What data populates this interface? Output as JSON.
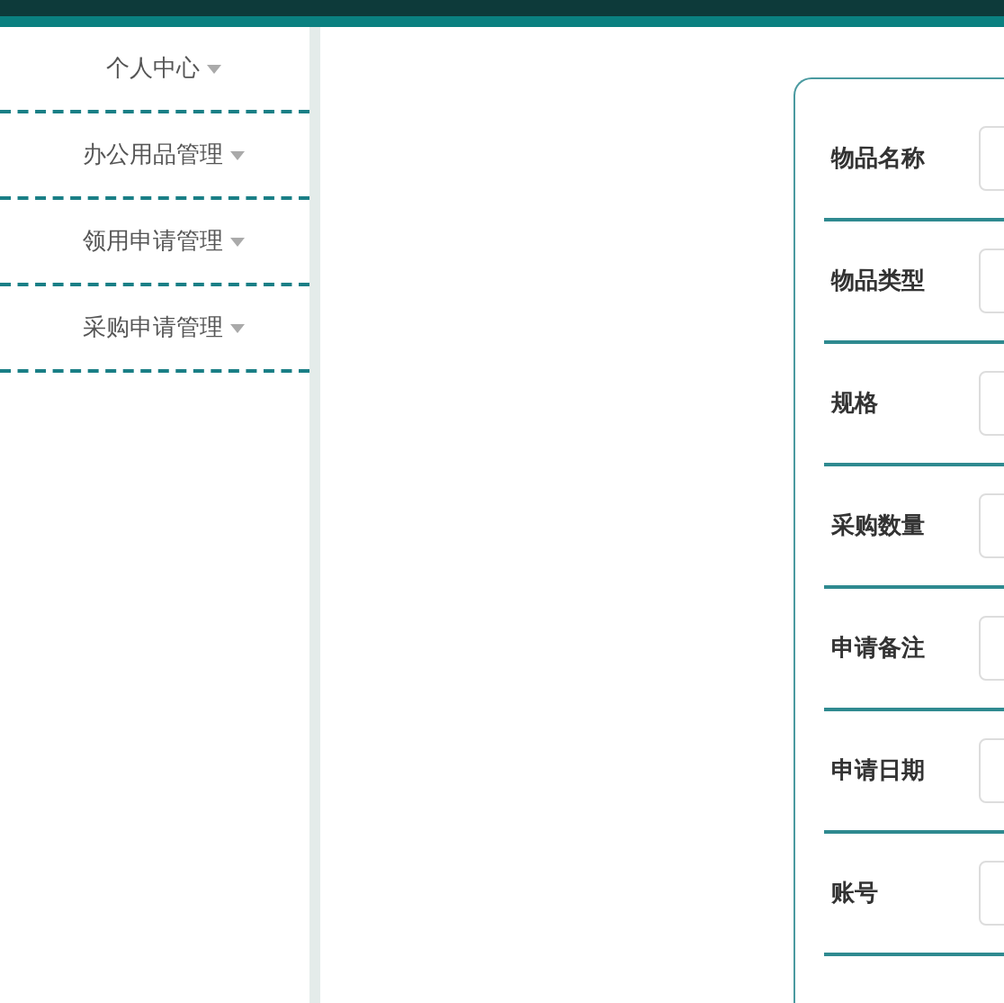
{
  "sidebar": {
    "items": [
      {
        "label": "个人中心",
        "expanded": false
      },
      {
        "label": "办公用品管理",
        "expanded": false
      },
      {
        "label": "领用申请管理",
        "expanded": false
      },
      {
        "label": "采购申请管理",
        "expanded": false
      }
    ]
  },
  "form": {
    "fields": [
      {
        "label": "物品名称"
      },
      {
        "label": "物品类型"
      },
      {
        "label": "规格"
      },
      {
        "label": "采购数量"
      },
      {
        "label": "申请备注"
      },
      {
        "label": "申请日期"
      },
      {
        "label": "账号"
      }
    ]
  }
}
